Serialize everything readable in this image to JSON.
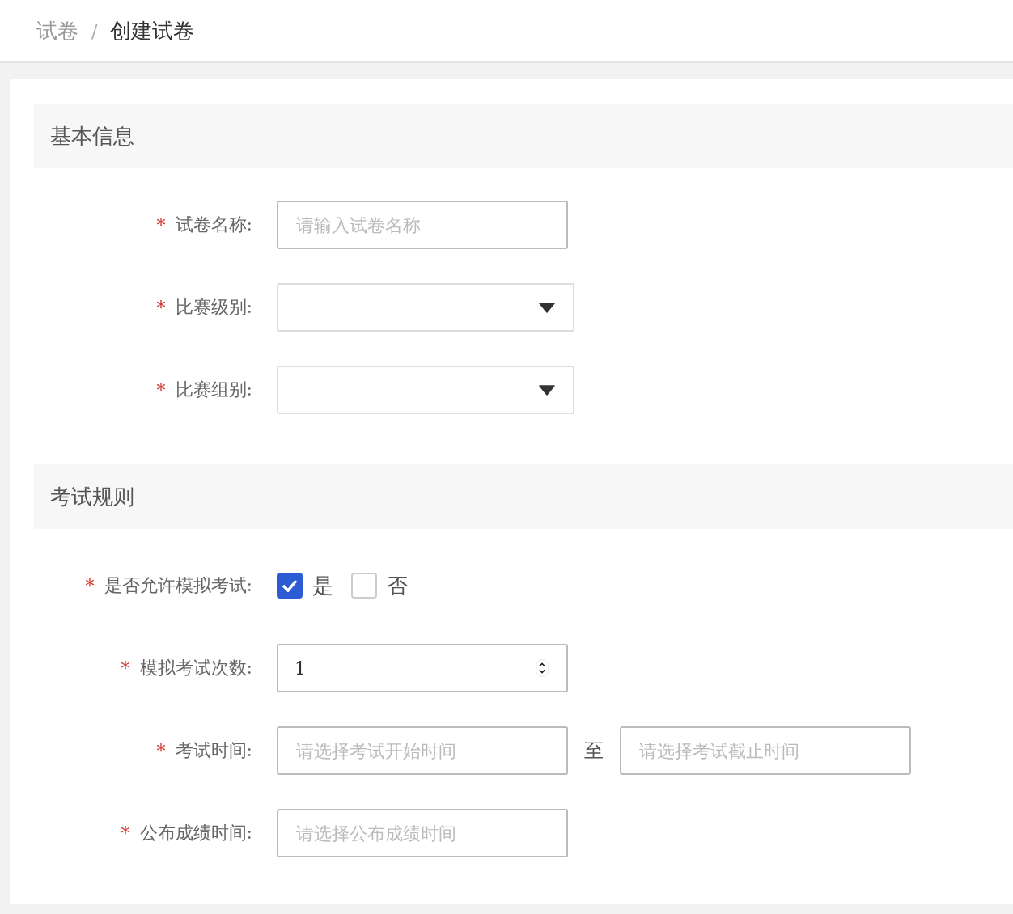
{
  "breadcrumb": {
    "items": [
      {
        "label": "试卷",
        "current": false
      },
      {
        "label": "创建试卷",
        "current": true
      }
    ],
    "separator": "/"
  },
  "sections": [
    {
      "title": "基本信息",
      "fields": [
        {
          "kind": "text",
          "required_mark": "*",
          "label": "试卷名称:",
          "placeholder": "请输入试卷名称"
        },
        {
          "kind": "select",
          "required_mark": "*",
          "label": "比赛级别:"
        },
        {
          "kind": "select",
          "required_mark": "*",
          "label": "比赛组别:"
        }
      ]
    },
    {
      "title": "考试规则",
      "fields": [
        {
          "kind": "checkboxes",
          "required_mark": "*",
          "label": "是否允许模拟考试:",
          "options": [
            {
              "label": "是",
              "checked": true
            },
            {
              "label": "否",
              "checked": false
            }
          ]
        },
        {
          "kind": "number",
          "required_mark": "*",
          "label": "模拟考试次数:",
          "value": "1"
        },
        {
          "kind": "range",
          "required_mark": "*",
          "label": "考试时间:",
          "start_placeholder": "请选择考试开始时间",
          "separator": "至",
          "end_placeholder": "请选择考试截止时间"
        },
        {
          "kind": "text",
          "required_mark": "*",
          "label": "公布成绩时间:",
          "placeholder": "请选择公布成绩时间"
        }
      ]
    }
  ]
}
